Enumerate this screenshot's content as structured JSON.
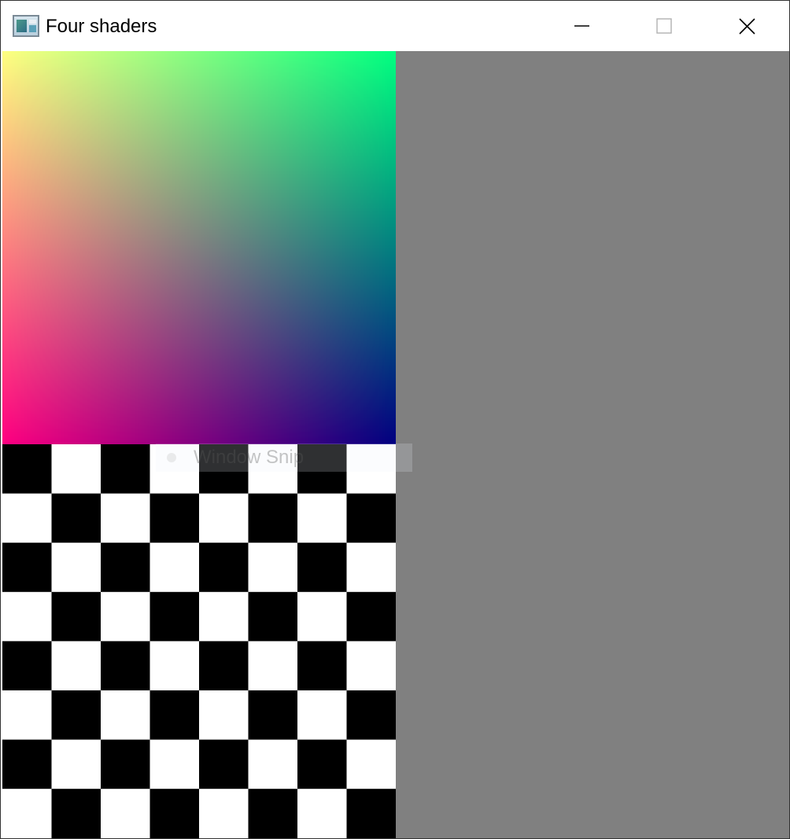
{
  "window": {
    "title": "Four shaders",
    "controls": {
      "minimize_icon": "minimize-icon",
      "maximize_icon": "maximize-icon",
      "close_icon": "close-icon"
    }
  },
  "overlay": {
    "label": "Window Snip"
  },
  "shaders": {
    "gradient": {
      "corner_colors": {
        "top_left": "#ffff80",
        "top_right": "#00ff80",
        "bottom_left": "#ff0080",
        "bottom_right": "#000080"
      }
    },
    "checkerboard": {
      "rows": 8,
      "cols": 8,
      "color_a": "#000000",
      "color_b": "#ffffff"
    },
    "solid": {
      "color": "#808080"
    }
  }
}
